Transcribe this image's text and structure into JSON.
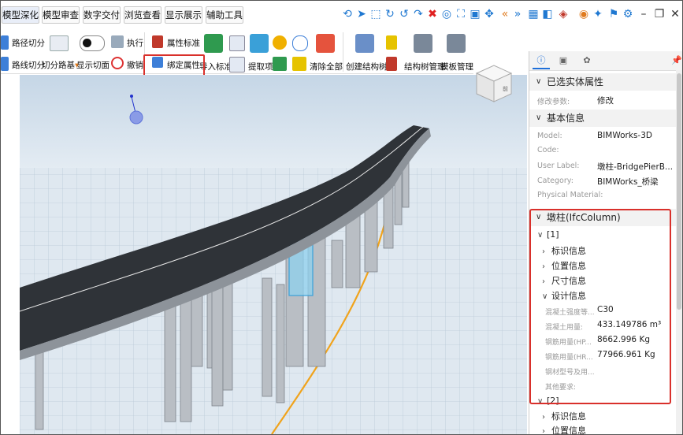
{
  "top_tabs": [
    {
      "label": "模型深化",
      "active": true
    },
    {
      "label": "模型审查",
      "active": false
    },
    {
      "label": "数字交付",
      "active": false
    },
    {
      "label": "浏览查看",
      "active": false
    },
    {
      "label": "显示展示",
      "active": false
    },
    {
      "label": "辅助工具",
      "active": false
    }
  ],
  "toolbar_icons": [
    "rotate-icon",
    "select-arrow-icon",
    "box-select-icon",
    "orbit-icon",
    "undo-icon",
    "redo-icon",
    "delete-x-icon",
    "hide-icon",
    "fit-view-icon",
    "frame-icon",
    "pan-icon",
    "prev-icon",
    "next-icon",
    "grid-icon",
    "cube-icon",
    "clip-icon",
    "record-icon",
    "pointer-star-icon",
    "flag-icon",
    "settings-icon"
  ],
  "window_controls": {
    "minimize": "–",
    "restore": "❐",
    "close": "✕"
  },
  "ribbon": {
    "path_cut": "路径切分",
    "route_cut": "路线切分",
    "cut_path_base": "切分路基",
    "show_section": "显示切面",
    "execute": "执行",
    "revoke": "撤销",
    "attr_standard": "属性标准",
    "bind_attr": "绑定属性",
    "import_standard": "导入标准",
    "extract_item": "提取项",
    "clear_all": "清除全部",
    "create_tree": "创建结构树",
    "tree_manage": "结构树管理",
    "template_manage": "模板管理"
  },
  "nav_cube": {
    "face_label": "前"
  },
  "panel": {
    "tabs": [
      "info-icon",
      "image-icon",
      "palette-icon"
    ],
    "pin_icon": "pin-icon",
    "selected_section": "已选实体属性",
    "modify_param_key": "修改参数:",
    "modify_param_val": "修改",
    "basic_section": "基本信息",
    "basic": [
      {
        "key": "Model:",
        "value": "BIMWorks-3D"
      },
      {
        "key": "Code:",
        "value": ""
      },
      {
        "key": "User Label:",
        "value": "墩柱-BridgePierB..."
      },
      {
        "key": "Category:",
        "value": "BIMWorks_桥梁"
      },
      {
        "key": "Physical Material:",
        "value": ""
      }
    ],
    "column_section": "墩柱(IfcColumn)",
    "item1": "[1]",
    "item1_children": [
      "标识信息",
      "位置信息",
      "尺寸信息"
    ],
    "design_info": "设计信息",
    "design": [
      {
        "key": "混凝土强度等...",
        "value": "C30"
      },
      {
        "key": "混凝土用量:",
        "value": "433.149786 m³"
      },
      {
        "key": "钢筋用量(HP...",
        "value": "8662.996 Kg"
      },
      {
        "key": "钢筋用量(HR...",
        "value": "77966.961 Kg"
      },
      {
        "key": "钢材型号及用...",
        "value": ""
      },
      {
        "key": "其他要求:",
        "value": ""
      }
    ],
    "item2": "[2]",
    "item2_children": [
      "标识信息",
      "位置信息"
    ]
  }
}
